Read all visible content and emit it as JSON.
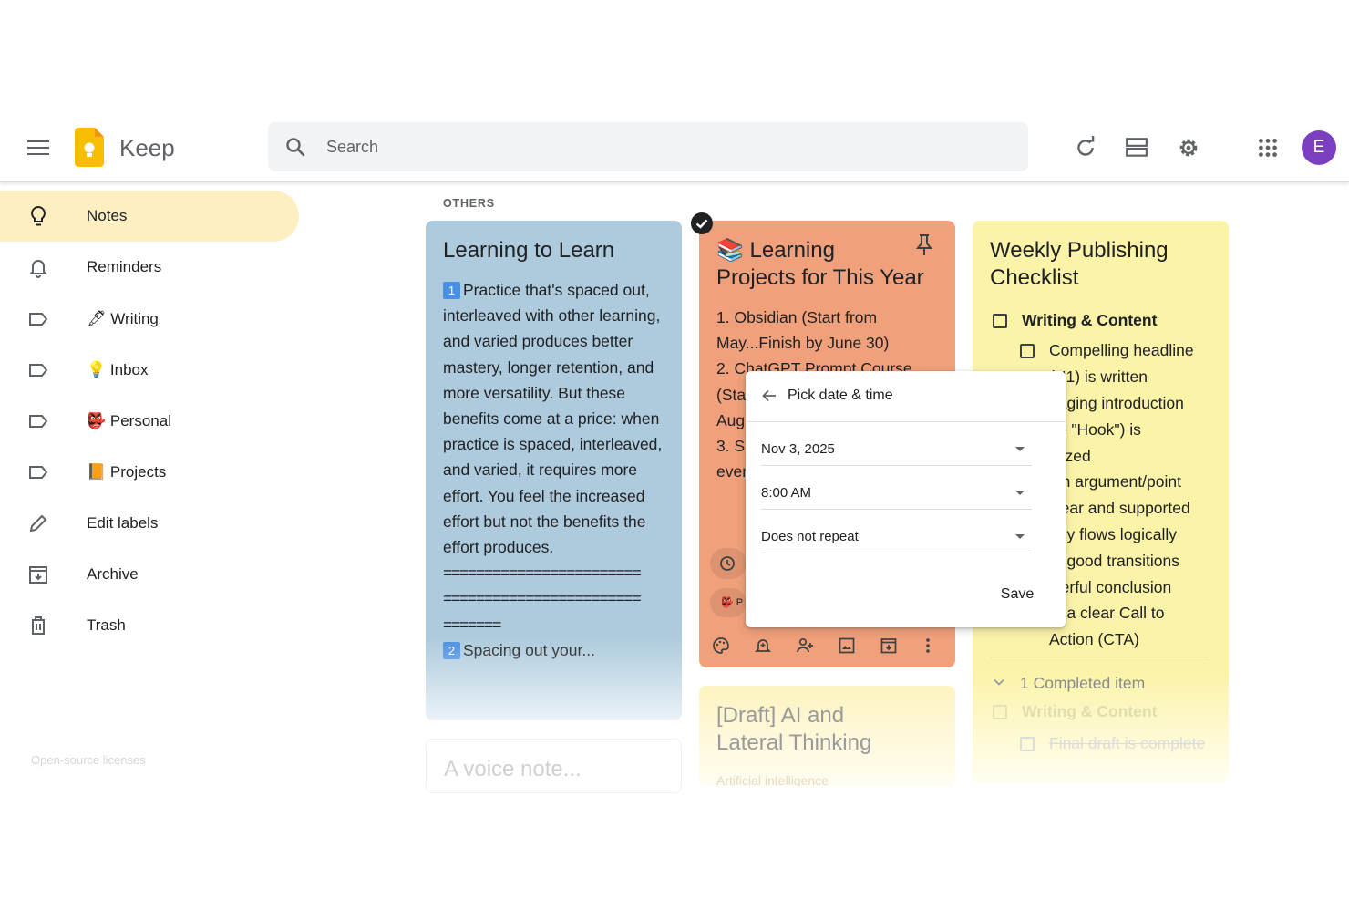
{
  "app": {
    "name": "Keep"
  },
  "header": {
    "search_placeholder": "Search",
    "avatar_initial": "E",
    "icons": [
      "menu-icon",
      "keep-logo",
      "search-icon",
      "refresh-icon",
      "list-view-icon",
      "settings-icon",
      "apps-grid-icon"
    ]
  },
  "sidebar": {
    "items": [
      {
        "label": "Notes",
        "icon": "lightbulb-icon",
        "active": true
      },
      {
        "label": "Reminders",
        "icon": "bell-icon"
      },
      {
        "label": "🖋 Writing",
        "icon": "label-icon"
      },
      {
        "label": "💡 Inbox",
        "icon": "label-icon"
      },
      {
        "label": "👺 Personal",
        "icon": "label-icon"
      },
      {
        "label": "📙 Projects",
        "icon": "label-icon"
      },
      {
        "label": "Edit labels",
        "icon": "pencil-icon"
      },
      {
        "label": "Archive",
        "icon": "archive-icon"
      },
      {
        "label": "Trash",
        "icon": "trash-icon"
      }
    ],
    "footer": "Open-source licenses"
  },
  "section_label": "OTHERS",
  "notes": {
    "learning": {
      "title": "Learning to Learn",
      "lines": [
        "Practice that's spaced out,",
        "interleaved with other learning,",
        "and varied produces better",
        "mastery, longer retention, and",
        "more versatility. But these",
        "benefits come at a price: when",
        "practice is spaced, interleaved,",
        "and varied, it requires more",
        "effort. You feel the increased",
        "effort but not the benefits the",
        "effort produces.",
        "========================",
        "========================",
        "======="
      ],
      "badge1": "1",
      "badge2": "2",
      "last_line": "Spacing out your...",
      "color": "#aecbdd"
    },
    "projects": {
      "title_line1": "📚 Learning",
      "title_line2": "Projects for This Year",
      "lines": [
        "1. Obsidian (Start from",
        "May...Finish by June 30)",
        "2. ChatGPT Prompt Course",
        "(Sta",
        "Aug",
        "3. Sl",
        "ever"
      ],
      "chip_label": "👺 P",
      "color": "#f0a07a"
    },
    "weekly": {
      "title_line1": "Weekly Publishing",
      "title_line2": "Checklist",
      "section": "Writing & Content",
      "items": [
        "Compelling headline",
        "(H1) is written",
        "gaging introduction",
        "he \"Hook\") is",
        "alized",
        "ain argument/point",
        "clear and supported",
        "ody flows logically",
        "th good transitions",
        "werful conclusion",
        "th a clear Call to",
        "Action (CTA)"
      ],
      "completed_label": "1 Completed item",
      "completed_section": "Writing & Content",
      "completed_item": "Final draft is complete",
      "color": "#fbf3a8"
    },
    "voice": {
      "title": "A voice note..."
    },
    "draft": {
      "title_line1": "[Draft] AI and",
      "title_line2": "Lateral Thinking",
      "label": "Artificial intelligence",
      "color": "#fdf6cc"
    }
  },
  "popup": {
    "title": "Pick date & time",
    "date": "Nov 3, 2025",
    "time": "8:00 AM",
    "repeat": "Does not repeat",
    "save": "Save"
  }
}
